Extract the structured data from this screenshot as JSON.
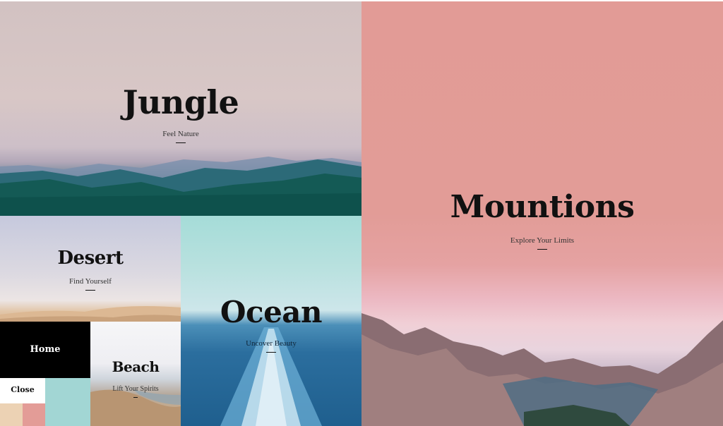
{
  "tiles": {
    "jungle": {
      "title": "Jungle",
      "subtitle": "Feel Nature"
    },
    "desert": {
      "title": "Desert",
      "subtitle": "Find Yourself"
    },
    "ocean": {
      "title": "Ocean",
      "subtitle": "Uncover Beauty"
    },
    "mountains": {
      "title": "Mountions",
      "subtitle": "Explore Your Limits"
    },
    "beach": {
      "title": "Beach",
      "subtitle": "Lift Your Spirits"
    }
  },
  "menu": {
    "home_label": "Home",
    "close_label": "Close"
  },
  "swatches": {
    "teal": "#a2d6d4",
    "tan": "#ecd2b4",
    "pink": "#e39c97"
  }
}
